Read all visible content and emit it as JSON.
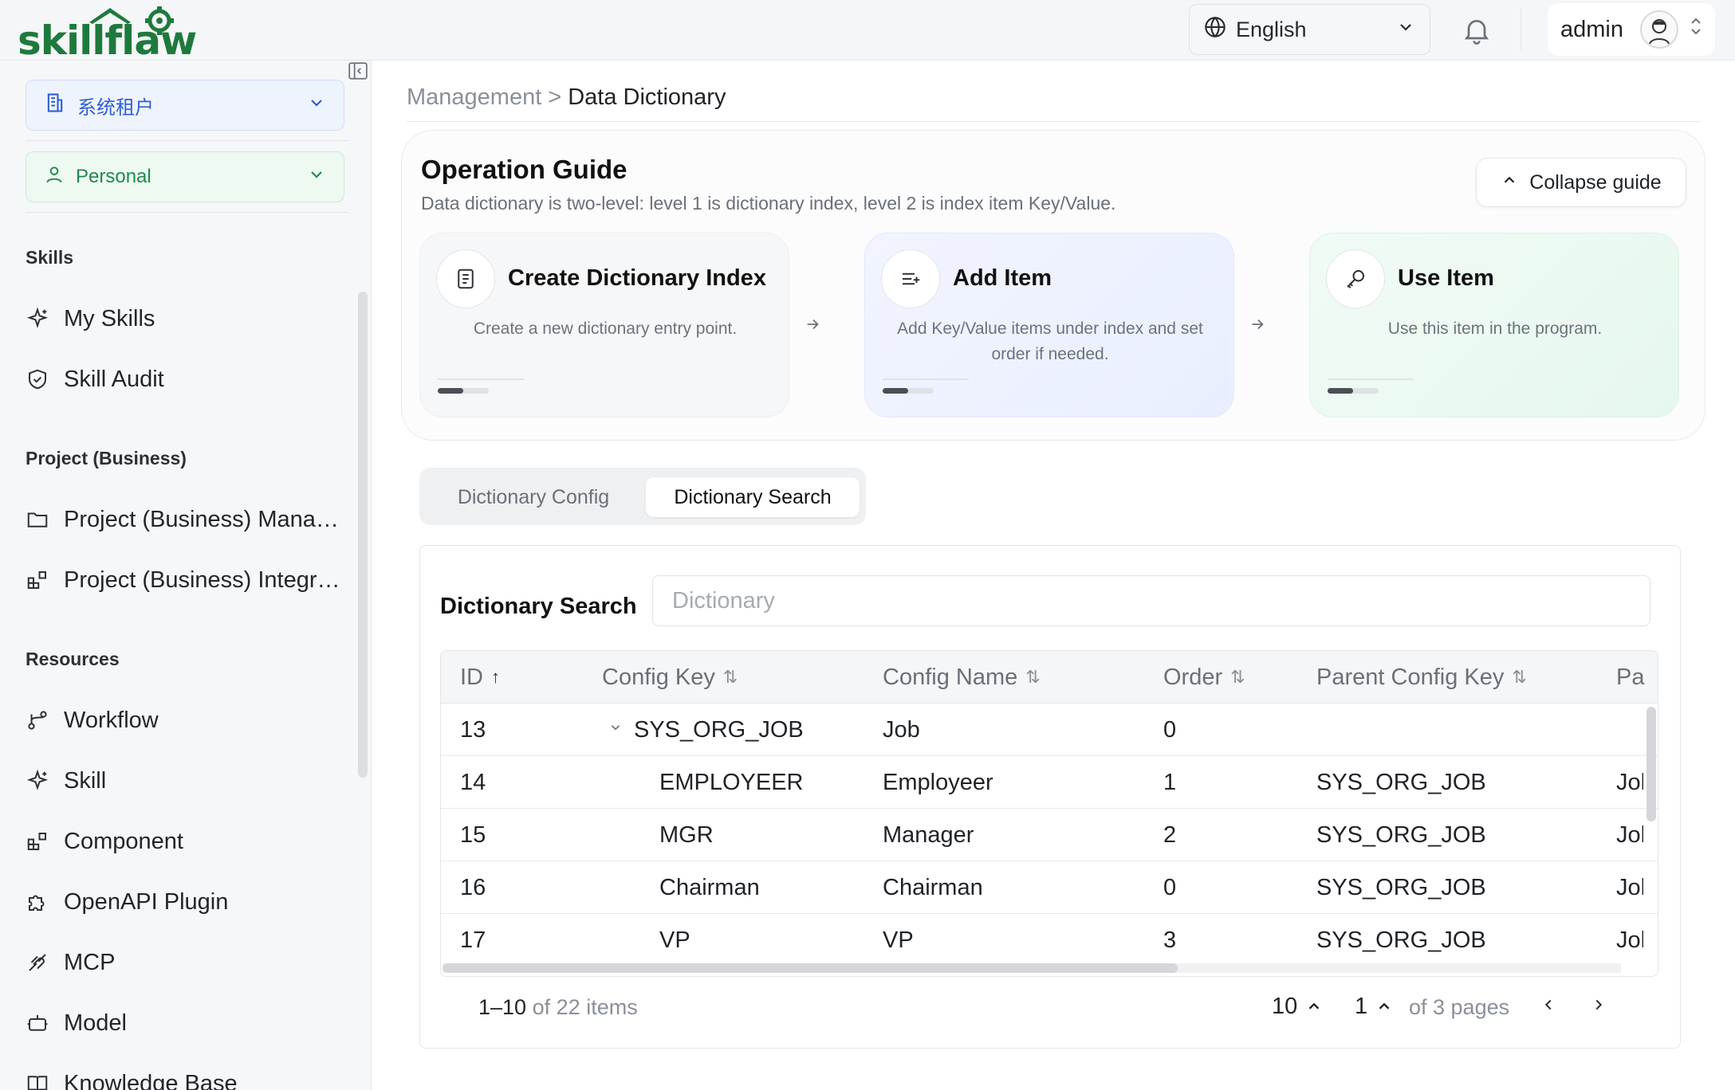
{
  "brand": {
    "logo_text": "skillflaw",
    "logo_color": "#1e7a3c"
  },
  "header": {
    "language": "English",
    "user": "admin"
  },
  "sidebar": {
    "tenant": "系统租户",
    "space": "Personal",
    "sections": [
      {
        "title": "Skills",
        "items": [
          {
            "label": "My Skills",
            "icon": "sparkle-icon"
          },
          {
            "label": "Skill Audit",
            "icon": "shield-check-icon"
          }
        ]
      },
      {
        "title": "Project (Business)",
        "items": [
          {
            "label": "Project (Business) Management",
            "icon": "folder-icon"
          },
          {
            "label": "Project (Business) Integration",
            "icon": "blocks-icon"
          }
        ]
      },
      {
        "title": "Resources",
        "items": [
          {
            "label": "Workflow",
            "icon": "workflow-icon"
          },
          {
            "label": "Skill",
            "icon": "sparkle-icon"
          },
          {
            "label": "Component",
            "icon": "blocks-icon"
          },
          {
            "label": "OpenAPI Plugin",
            "icon": "puzzle-icon"
          },
          {
            "label": "MCP",
            "icon": "mcp-icon"
          },
          {
            "label": "Model",
            "icon": "bot-icon"
          },
          {
            "label": "Knowledge Base",
            "icon": "book-icon"
          }
        ]
      }
    ]
  },
  "breadcrumb": {
    "parent": "Management",
    "separator": ">",
    "current": "Data Dictionary"
  },
  "guide": {
    "title": "Operation Guide",
    "description": "Data dictionary is two-level: level 1 is dictionary index, level 2 is index item Key/Value.",
    "collapse_label": "Collapse guide",
    "steps": [
      {
        "title": "Create Dictionary Index",
        "description": "Create a new dictionary entry point.",
        "icon": "document-icon"
      },
      {
        "title": "Add Item",
        "description": "Add Key/Value items under index and set order if needed.",
        "icon": "list-add-icon"
      },
      {
        "title": "Use Item",
        "description": "Use this item in the program.",
        "icon": "key-icon"
      }
    ]
  },
  "tabs": [
    {
      "label": "Dictionary Config",
      "active": false
    },
    {
      "label": "Dictionary Search",
      "active": true
    }
  ],
  "search": {
    "label": "Dictionary Search",
    "placeholder": "Dictionary",
    "value": ""
  },
  "table": {
    "columns": [
      "ID",
      "Config Key",
      "Config Name",
      "Order",
      "Parent Config Key",
      "Pa"
    ],
    "rows": [
      {
        "id": "13",
        "key": "SYS_ORG_JOB",
        "name": "Job",
        "order": "0",
        "parent": "",
        "extra": "",
        "expandable": true
      },
      {
        "id": "14",
        "key": "EMPLOYEER",
        "name": "Employeer",
        "order": "1",
        "parent": "SYS_ORG_JOB",
        "extra": "Jol"
      },
      {
        "id": "15",
        "key": "MGR",
        "name": "Manager",
        "order": "2",
        "parent": "SYS_ORG_JOB",
        "extra": "Jol"
      },
      {
        "id": "16",
        "key": "Chairman",
        "name": "Chairman",
        "order": "0",
        "parent": "SYS_ORG_JOB",
        "extra": "Jol"
      },
      {
        "id": "17",
        "key": "VP",
        "name": "VP",
        "order": "3",
        "parent": "SYS_ORG_JOB",
        "extra": "Jol"
      }
    ]
  },
  "pagination": {
    "range": "1–10",
    "of_label": "of",
    "total": "22",
    "items_label": "items",
    "page_size": "10",
    "current_page": "1",
    "pages_label": "of 3 pages"
  },
  "colors": {
    "primary_blue": "#2f5fd0",
    "green": "#1f8a4c",
    "text": "#1f2328",
    "muted": "#8a9099"
  }
}
